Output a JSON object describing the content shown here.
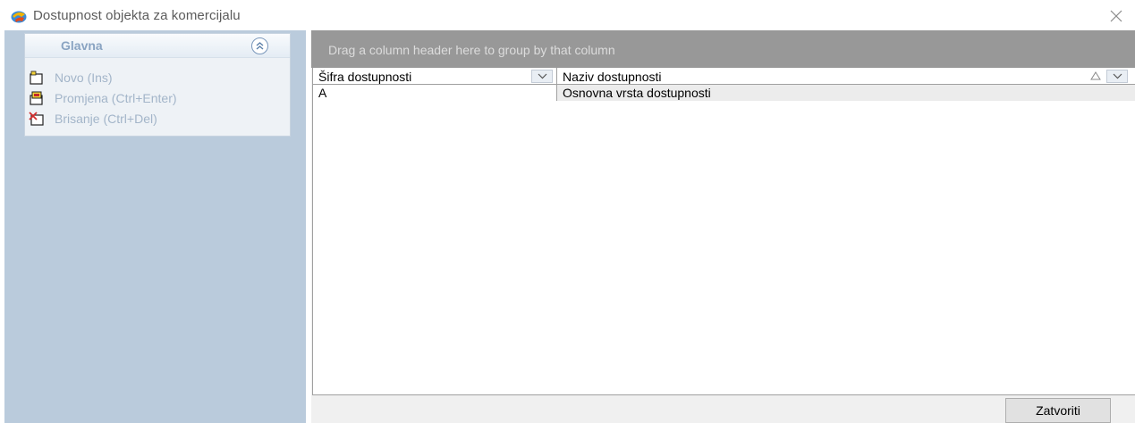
{
  "window": {
    "title": "Dostupnost objekta za komercijalu",
    "app_icon": "app-logo-icon",
    "close_icon": "close-icon"
  },
  "sidebar": {
    "group_title": "Glavna",
    "collapse_icon": "chevron-double-up-icon",
    "items": [
      {
        "label": "Novo (Ins)",
        "icon": "new-document-icon"
      },
      {
        "label": "Promjena (Ctrl+Enter)",
        "icon": "edit-document-icon"
      },
      {
        "label": "Brisanje (Ctrl+Del)",
        "icon": "delete-document-icon"
      }
    ]
  },
  "grid": {
    "group_by_hint": "Drag a column header here to group by that column",
    "columns": [
      {
        "header": "Šifra dostupnosti",
        "filter_icon": "filter-dropdown-icon"
      },
      {
        "header": "Naziv dostupnosti",
        "filter_icon": "filter-dropdown-icon",
        "sort": "ascending"
      }
    ],
    "rows": [
      {
        "sifra": "A",
        "naziv": "Osnovna vrsta dostupnosti"
      }
    ]
  },
  "footer": {
    "close_label": "Zatvoriti"
  }
}
